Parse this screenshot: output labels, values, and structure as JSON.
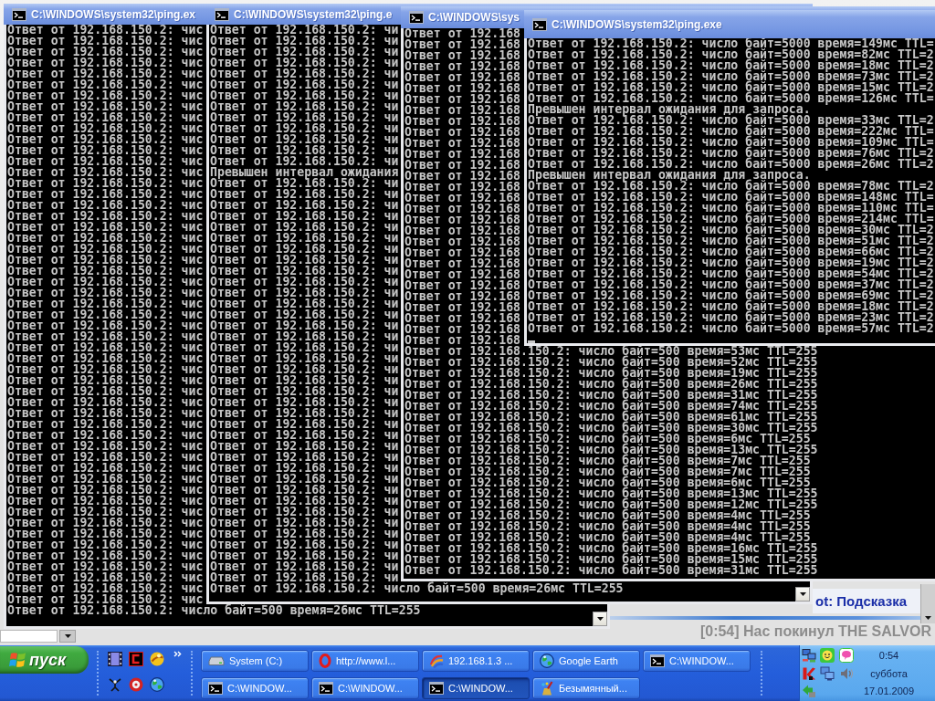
{
  "windows": [
    {
      "title": "C:\\WINDOWS\\system32\\ping.ex",
      "cursor": false,
      "lines": [
        "Ответ от 192.168.150.2: чис",
        "Ответ от 192.168.150.2: чис",
        "Ответ от 192.168.150.2: чис",
        "Ответ от 192.168.150.2: чис",
        "Ответ от 192.168.150.2: чис",
        "Ответ от 192.168.150.2: чис",
        "Ответ от 192.168.150.2: чис",
        "Ответ от 192.168.150.2: чис",
        "Ответ от 192.168.150.2: чис",
        "Ответ от 192.168.150.2: чис",
        "Ответ от 192.168.150.2: чис",
        "Ответ от 192.168.150.2: чис",
        "Ответ от 192.168.150.2: чис",
        "Ответ от 192.168.150.2: чис",
        "Ответ от 192.168.150.2: чис",
        "Ответ от 192.168.150.2: чис",
        "Ответ от 192.168.150.2: чис",
        "Ответ от 192.168.150.2: чис",
        "Ответ от 192.168.150.2: чис",
        "Ответ от 192.168.150.2: чис",
        "Ответ от 192.168.150.2: чис",
        "Ответ от 192.168.150.2: чис",
        "Ответ от 192.168.150.2: чис",
        "Ответ от 192.168.150.2: чис",
        "Ответ от 192.168.150.2: чис",
        "Ответ от 192.168.150.2: чис",
        "Ответ от 192.168.150.2: чис",
        "Ответ от 192.168.150.2: чис",
        "Ответ от 192.168.150.2: чис",
        "Ответ от 192.168.150.2: чис",
        "Ответ от 192.168.150.2: чис",
        "Ответ от 192.168.150.2: чис",
        "Ответ от 192.168.150.2: чис",
        "Ответ от 192.168.150.2: чис",
        "Ответ от 192.168.150.2: чис",
        "Ответ от 192.168.150.2: чис",
        "Ответ от 192.168.150.2: чис",
        "Ответ от 192.168.150.2: чис",
        "Ответ от 192.168.150.2: чис",
        "Ответ от 192.168.150.2: чис",
        "Ответ от 192.168.150.2: чис",
        "Ответ от 192.168.150.2: чис",
        "Ответ от 192.168.150.2: чис",
        "Ответ от 192.168.150.2: чис",
        "Ответ от 192.168.150.2: чис",
        "Ответ от 192.168.150.2: чис",
        "Ответ от 192.168.150.2: чис",
        "Ответ от 192.168.150.2: чис",
        "Ответ от 192.168.150.2: чис",
        "Ответ от 192.168.150.2: чис",
        "Ответ от 192.168.150.2: чис",
        "Ответ от 192.168.150.2: чис",
        "Ответ от 192.168.150.2: чис",
        "Ответ от 192.168.150.2: число байт=500 время=26мс TTL=255"
      ]
    },
    {
      "title": "C:\\WINDOWS\\system32\\ping.e",
      "cursor": false,
      "lines": [
        "Ответ от 192.168.150.2: чи",
        "Ответ от 192.168.150.2: чи",
        "Ответ от 192.168.150.2: чи",
        "Ответ от 192.168.150.2: чи",
        "Ответ от 192.168.150.2: чи",
        "Ответ от 192.168.150.2: чи",
        "Ответ от 192.168.150.2: чи",
        "Ответ от 192.168.150.2: чи",
        "Ответ от 192.168.150.2: чи",
        "Ответ от 192.168.150.2: чи",
        "Ответ от 192.168.150.2: чи",
        "Ответ от 192.168.150.2: чи",
        "Ответ от 192.168.150.2: чи",
        "Превышен интервал ожидания",
        "Ответ от 192.168.150.2: чи",
        "Ответ от 192.168.150.2: чи",
        "Ответ от 192.168.150.2: чи",
        "Ответ от 192.168.150.2: чи",
        "Ответ от 192.168.150.2: чи",
        "Ответ от 192.168.150.2: чи",
        "Ответ от 192.168.150.2: чи",
        "Ответ от 192.168.150.2: чи",
        "Ответ от 192.168.150.2: чи",
        "Ответ от 192.168.150.2: чи",
        "Ответ от 192.168.150.2: чи",
        "Ответ от 192.168.150.2: чи",
        "Ответ от 192.168.150.2: чи",
        "Ответ от 192.168.150.2: чи",
        "Ответ от 192.168.150.2: чи",
        "Ответ от 192.168.150.2: чи",
        "Ответ от 192.168.150.2: чи",
        "Ответ от 192.168.150.2: чи",
        "Ответ от 192.168.150.2: чи",
        "Ответ от 192.168.150.2: чи",
        "Ответ от 192.168.150.2: чи",
        "Ответ от 192.168.150.2: чи",
        "Ответ от 192.168.150.2: чи",
        "Ответ от 192.168.150.2: чи",
        "Ответ от 192.168.150.2: чи",
        "Ответ от 192.168.150.2: чи",
        "Ответ от 192.168.150.2: чи",
        "Ответ от 192.168.150.2: чи",
        "Ответ от 192.168.150.2: чи",
        "Ответ от 192.168.150.2: чи",
        "Ответ от 192.168.150.2: чи",
        "Ответ от 192.168.150.2: чи",
        "Ответ от 192.168.150.2: чи",
        "Ответ от 192.168.150.2: чи",
        "Ответ от 192.168.150.2: чи",
        "Ответ от 192.168.150.2: чи",
        "Ответ от 192.168.150.2: чи",
        "Ответ от 192.168.150.2: число байт=500 время=26мс TTL=255"
      ]
    },
    {
      "title": "C:\\WINDOWS\\sys",
      "cursor": false,
      "lines": [
        "Ответ от 192.168",
        "Ответ от 192.168",
        "Ответ от 192.168",
        "Ответ от 192.168",
        "Ответ от 192.168",
        "Ответ от 192.168",
        "Ответ от 192.168",
        "Ответ от 192.168",
        "Ответ от 192.168",
        "Ответ от 192.168",
        "Ответ от 192.168",
        "Ответ от 192.168",
        "Ответ от 192.168",
        "Ответ от 192.168",
        "Ответ от 192.168",
        "Ответ от 192.168",
        "Ответ от 192.168",
        "Ответ от 192.168",
        "Ответ от 192.168",
        "Ответ от 192.168",
        "Ответ от 192.168",
        "Ответ от 192.168",
        "Ответ от 192.168",
        "Ответ от 192.168",
        "Ответ от 192.168",
        "Ответ от 192.168",
        "Ответ от 192.168",
        "Ответ от 192.168",
        "Ответ от 192.168",
        "Ответ от 192.168.150.2: число байт=500 время=53мс TTL=255",
        "Ответ от 192.168.150.2: число байт=500 время=52мс TTL=255",
        "Ответ от 192.168.150.2: число байт=500 время=19мс TTL=255",
        "Ответ от 192.168.150.2: число байт=500 время=26мс TTL=255",
        "Ответ от 192.168.150.2: число байт=500 время=31мс TTL=255",
        "Ответ от 192.168.150.2: число байт=500 время=74мс TTL=255",
        "Ответ от 192.168.150.2: число байт=500 время=61мс TTL=255",
        "Ответ от 192.168.150.2: число байт=500 время=30мс TTL=255",
        "Ответ от 192.168.150.2: число байт=500 время=6мс TTL=255",
        "Ответ от 192.168.150.2: число байт=500 время=13мс TTL=255",
        "Ответ от 192.168.150.2: число байт=500 время=7мс TTL=255",
        "Ответ от 192.168.150.2: число байт=500 время=7мс TTL=255",
        "Ответ от 192.168.150.2: число байт=500 время=6мс TTL=255",
        "Ответ от 192.168.150.2: число байт=500 время=13мс TTL=255",
        "Ответ от 192.168.150.2: число байт=500 время=12мс TTL=255",
        "Ответ от 192.168.150.2: число байт=500 время=4мс TTL=255",
        "Ответ от 192.168.150.2: число байт=500 время=4мс TTL=255",
        "Ответ от 192.168.150.2: число байт=500 время=4мс TTL=255",
        "Ответ от 192.168.150.2: число байт=500 время=16мс TTL=255",
        "Ответ от 192.168.150.2: число байт=500 время=15мс TTL=255",
        "Ответ от 192.168.150.2: число байт=500 время=31мс TTL=255"
      ]
    },
    {
      "title": "C:\\WINDOWS\\system32\\ping.exe",
      "cursor": true,
      "lines": [
        "Ответ от 192.168.150.2: число байт=5000 время=149мс TTL=",
        "Ответ от 192.168.150.2: число байт=5000 время=82мс TTL=2",
        "Ответ от 192.168.150.2: число байт=5000 время=18мс TTL=2",
        "Ответ от 192.168.150.2: число байт=5000 время=73мс TTL=2",
        "Ответ от 192.168.150.2: число байт=5000 время=15мс TTL=2",
        "Ответ от 192.168.150.2: число байт=5000 время=126мс TTL=",
        "Превышен интервал ожидания для запроса.",
        "Ответ от 192.168.150.2: число байт=5000 время=33мс TTL=2",
        "Ответ от 192.168.150.2: число байт=5000 время=222мс TTL=",
        "Ответ от 192.168.150.2: число байт=5000 время=109мс TTL=",
        "Ответ от 192.168.150.2: число байт=5000 время=76мс TTL=2",
        "Ответ от 192.168.150.2: число байт=5000 время=26мс TTL=2",
        "Превышен интервал ожидания для запроса.",
        "Ответ от 192.168.150.2: число байт=5000 время=78мс TTL=2",
        "Ответ от 192.168.150.2: число байт=5000 время=148мс TTL=",
        "Ответ от 192.168.150.2: число байт=5000 время=110мс TTL=",
        "Ответ от 192.168.150.2: число байт=5000 время=214мс TTL=",
        "Ответ от 192.168.150.2: число байт=5000 время=30мс TTL=2",
        "Ответ от 192.168.150.2: число байт=5000 время=51мс TTL=2",
        "Ответ от 192.168.150.2: число байт=5000 время=66мс TTL=2",
        "Ответ от 192.168.150.2: число байт=5000 время=19мс TTL=2",
        "Ответ от 192.168.150.2: число байт=5000 время=54мс TTL=2",
        "Ответ от 192.168.150.2: число байт=5000 время=37мс TTL=2",
        "Ответ от 192.168.150.2: число байт=5000 время=69мс TTL=2",
        "Ответ от 192.168.150.2: число байт=5000 время=18мс TTL=2",
        "Ответ от 192.168.150.2: число байт=5000 время=23мс TTL=2",
        "Ответ от 192.168.150.2: число байт=5000 время=57мс TTL=2"
      ]
    }
  ],
  "chat": {
    "header": "ot: Подсказка",
    "message": "[0:54] Нас покинул THE SALVOR"
  },
  "taskbar": {
    "start_label": "пуск",
    "buttons": [
      {
        "label": "System (C:)",
        "selected": false
      },
      {
        "label": "http://www.l...",
        "selected": false
      },
      {
        "label": "192.168.1.3 ...",
        "selected": false
      },
      {
        "label": "Google Earth",
        "selected": false
      },
      {
        "label": "C:\\WINDOW...",
        "selected": false
      },
      {
        "label": "C:\\WINDOW...",
        "selected": false
      },
      {
        "label": "C:\\WINDOW...",
        "selected": false
      },
      {
        "label": "C:\\WINDOW...",
        "selected": true
      },
      {
        "label": "Безымянный...",
        "selected": false
      }
    ],
    "clock": {
      "time": "0:54",
      "day": "суббота",
      "date": "17.01.2009"
    }
  }
}
